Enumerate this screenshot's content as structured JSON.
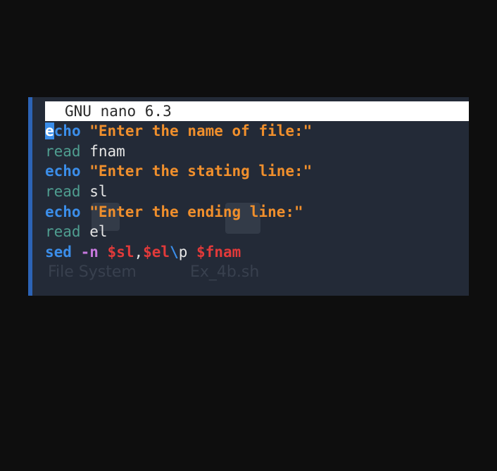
{
  "title_bar": {
    "app": "GNU nano 6.3"
  },
  "background_desktop": {
    "icon_labels": [
      "File System",
      "Ex_4b.sh"
    ]
  },
  "editor": {
    "lines": [
      {
        "cursor_char": "e",
        "keyword_rest": "cho",
        "string": "\"Enter the name of file:\""
      },
      {
        "keyword": "read",
        "arg": "fnam"
      },
      {
        "keyword": "echo",
        "string": "\"Enter the stating line:\""
      },
      {
        "keyword": "read",
        "arg": "sl"
      },
      {
        "keyword": "echo",
        "string": "\"Enter the ending line:\""
      },
      {
        "keyword": "read",
        "arg": "el"
      },
      {
        "keyword": "sed",
        "option": "-n",
        "var1": "$sl",
        "comma": ",",
        "var2": "$el",
        "backslash": "\\",
        "print_cmd": "p",
        "var3": "$fnam"
      }
    ]
  },
  "colors": {
    "background": "#0e0e0e",
    "editor_bg": "#232a37",
    "accent": "#2c63b6",
    "keyword_echo": "#3b8eea",
    "keyword_read": "#4f9e90",
    "string": "#f08f2c",
    "variable": "#e23a3a",
    "option": "#c678dd"
  }
}
